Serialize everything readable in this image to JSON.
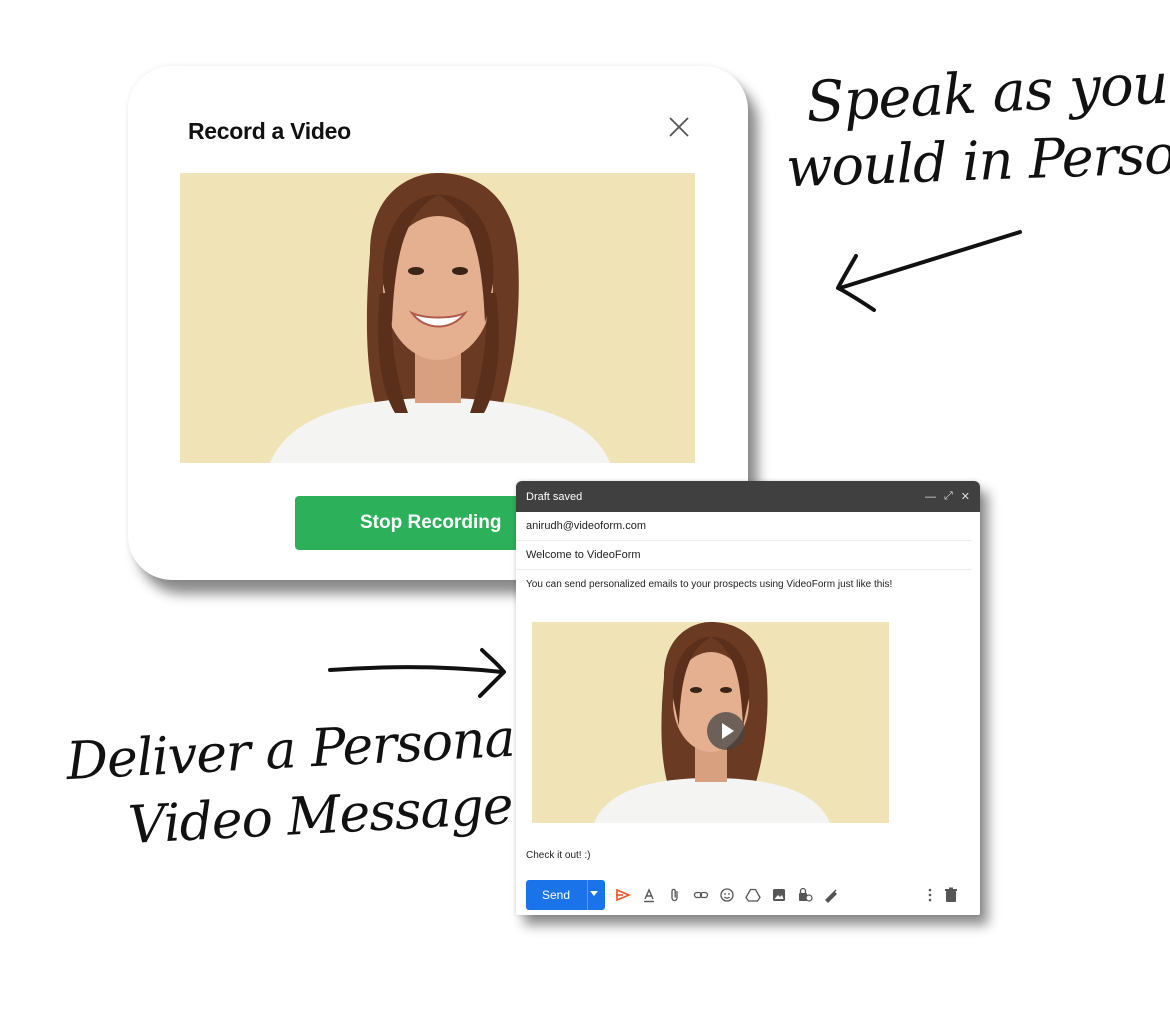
{
  "record_modal": {
    "title": "Record a Video",
    "stop_label": "Stop Recording"
  },
  "compose": {
    "header_title": "Draft saved",
    "to": "anirudh@videoform.com",
    "subject": "Welcome to VideoForm",
    "body": "You can send personalized emails to your prospects using VideoForm just like this!",
    "signoff": "Check it out! :)",
    "send_label": "Send"
  },
  "captions": {
    "top_line1": "Speak as you",
    "top_line2": "would in Person",
    "bottom_line1": "Deliver a Personal",
    "bottom_line2": "Video Message"
  },
  "colors": {
    "stop_button": "#2db05a",
    "send_button": "#1a73e8",
    "compose_header": "#404040",
    "video_background": "#f0e3b6"
  }
}
